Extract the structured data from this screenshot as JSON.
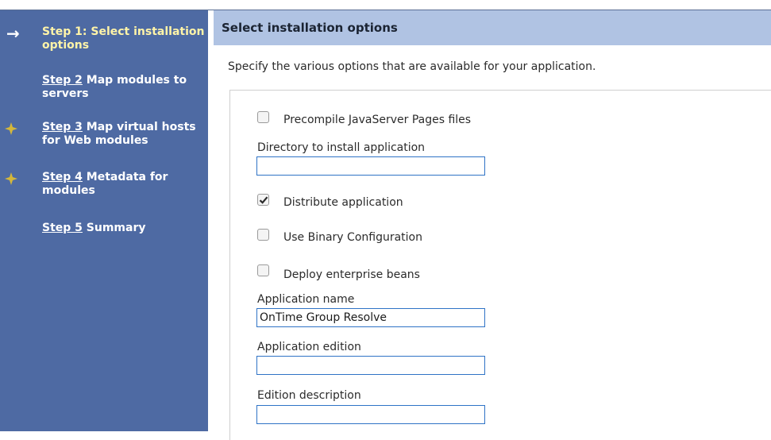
{
  "sidebar": {
    "steps": [
      {
        "link": "",
        "text": "Step 1: Select installation options"
      },
      {
        "link": "Step 2",
        "text": " Map modules to servers"
      },
      {
        "link": "Step 3",
        "text": " Map virtual hosts for Web modules"
      },
      {
        "link": "Step 4",
        "text": " Metadata for modules"
      },
      {
        "link": "Step 5",
        "text": " Summary"
      }
    ]
  },
  "main": {
    "title": "Select installation options",
    "description": "Specify the various options that are available for your application.",
    "options": {
      "precompile": {
        "label": "Precompile JavaServer Pages files",
        "checked": false
      },
      "distribute": {
        "label": "Distribute application",
        "checked": true
      },
      "binary": {
        "label": "Use Binary Configuration",
        "checked": false
      },
      "deploy_ejb": {
        "label": "Deploy enterprise beans",
        "checked": false
      }
    },
    "fields": {
      "install_dir": {
        "label": "Directory to install application",
        "value": ""
      },
      "app_name": {
        "label": "Application name",
        "value": "OnTime Group Resolve"
      },
      "app_edition": {
        "label": "Application edition",
        "value": ""
      },
      "edition_desc": {
        "label": "Edition description",
        "value": ""
      }
    }
  },
  "colors": {
    "sidebar_bg": "#4e6aa3",
    "header_bg": "#b0c3e3",
    "current_step": "#fff4a8",
    "input_border": "#2f73c6",
    "star": "#d4b73a"
  },
  "icons": {
    "current": "arrow-right-icon",
    "incomplete": "star-icon"
  }
}
